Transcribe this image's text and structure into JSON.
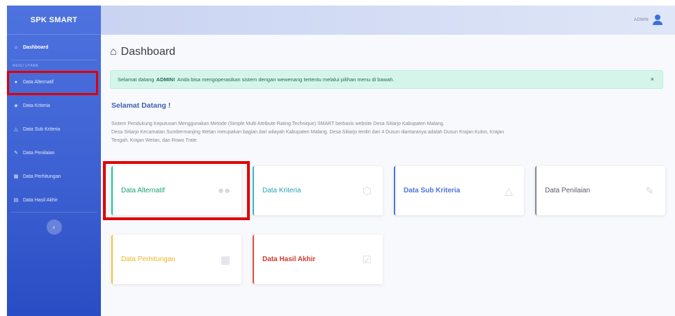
{
  "sidebar": {
    "brand": "SPK SMART",
    "dashboard_label": "Dashboard",
    "section_heading": "MENU UTAMA",
    "items": [
      {
        "label": "Data Alternatif"
      },
      {
        "label": "Data Kriteria"
      },
      {
        "label": "Data Sub Kriteria"
      },
      {
        "label": "Data Penilaian"
      },
      {
        "label": "Data Perhitungan"
      },
      {
        "label": "Data Hasil Akhir"
      }
    ],
    "toggle_icon": "‹"
  },
  "topbar": {
    "user_name": "ADMIN",
    "user_icon": "user-icon"
  },
  "main": {
    "page_title": "Dashboard",
    "alert": {
      "prefix": "Selamat datang",
      "user": "ADMIN!",
      "suffix": "Anda bisa mengoperasikan sistem dengan wewenang tertentu melalui pilihan menu di bawah.",
      "close": "×"
    },
    "welcome_title": "Selamat Datang !",
    "welcome_line1": "Sistem Pendukung Keputusan Menggunakan Metode (Simple Multi Attribute Rating Technique) SMART berbasis website Desa Sitiarjo Kabupaten Malang.",
    "welcome_line2": "Desa Sitiarjo Kecamatan Sumbermanjing Wetan merupakan bagian dari wilayah Kabupaten Malang. Desa Sitiarjo terdiri dari 4 Dusun diantaranya adalah Dusun Krajan Kulon, Krajan",
    "welcome_line3": "Tengah, Krajan Wetan, dan Rowo Trate.",
    "cards": [
      {
        "label": "Data Alternatif",
        "icon": "users-icon"
      },
      {
        "label": "Data Kriteria",
        "icon": "cube-icon"
      },
      {
        "label": "Data Sub Kriteria",
        "icon": "cubes-icon"
      },
      {
        "label": "Data Penilaian",
        "icon": "edit-icon"
      },
      {
        "label": "Data Perhitungan",
        "icon": "calculator-icon"
      },
      {
        "label": "Data Hasil Akhir",
        "icon": "calendar-check-icon"
      }
    ]
  },
  "colors": {
    "sidebar": "#4e73df",
    "highlight": "#e00000",
    "success": "#1cc88a",
    "info": "#36b9cc",
    "primary": "#4e73df",
    "secondary": "#858796",
    "warning": "#f6c23e",
    "danger": "#e74a3b"
  }
}
